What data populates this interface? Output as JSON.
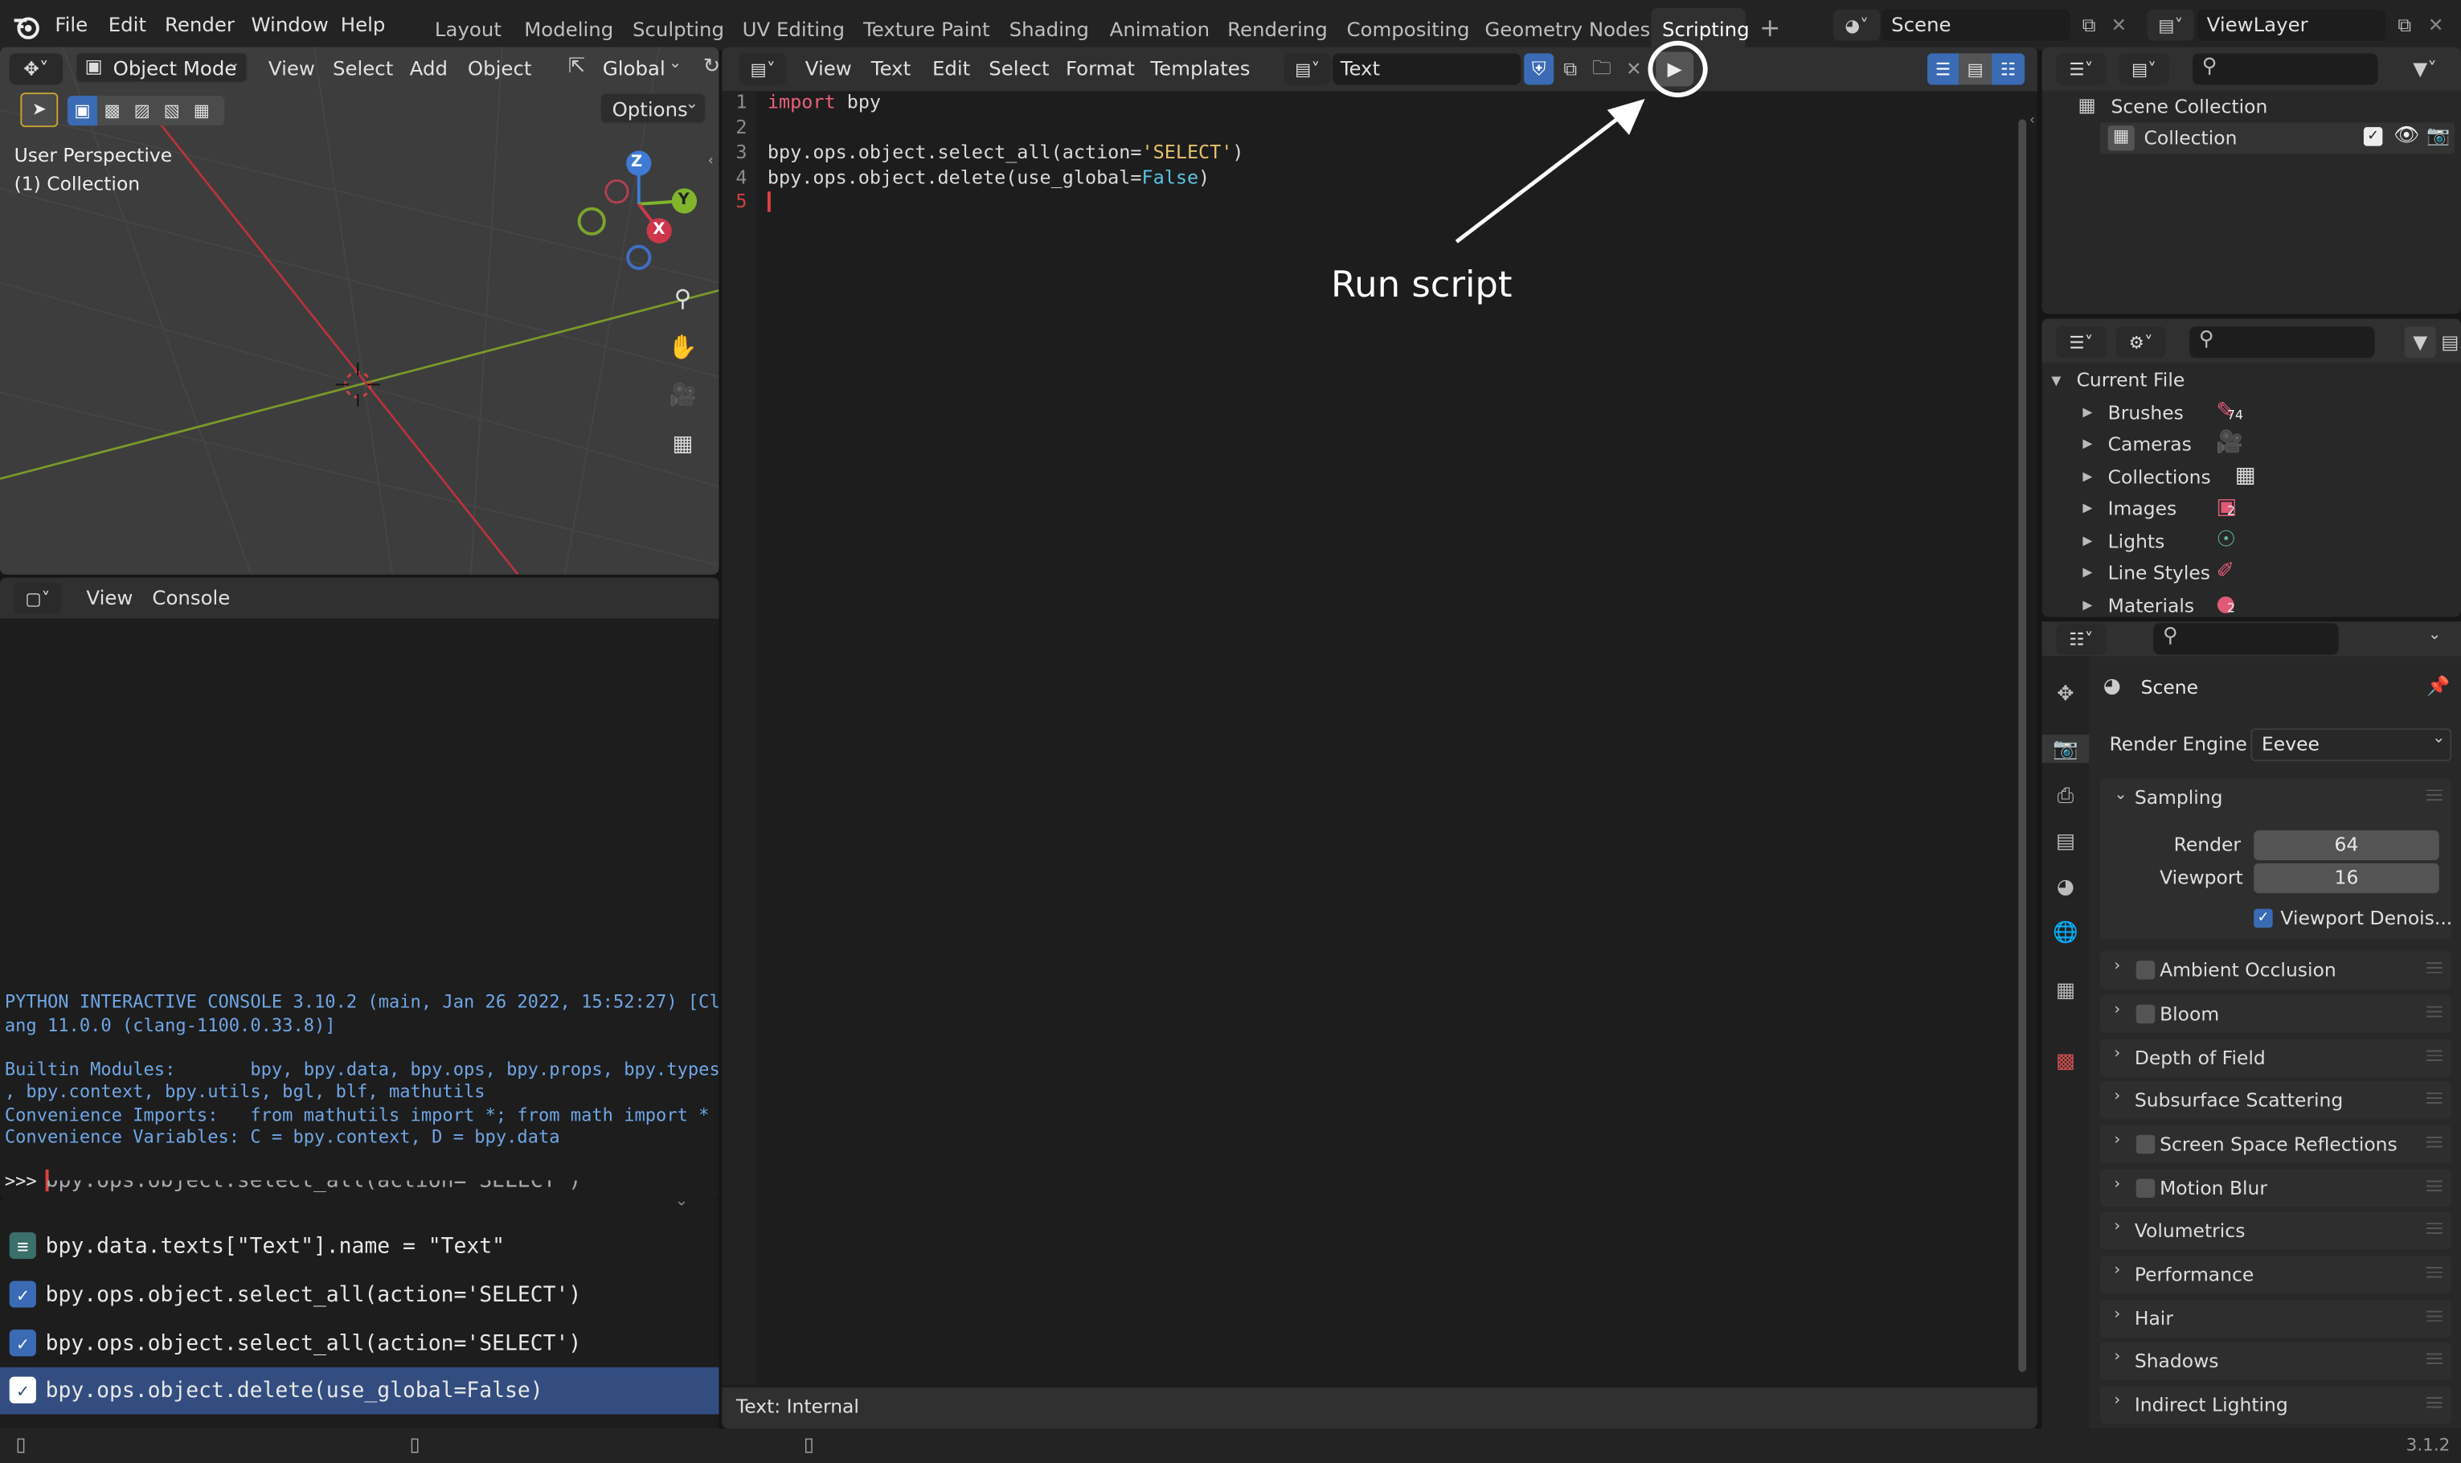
{
  "menubar": {
    "items": [
      "File",
      "Edit",
      "Render",
      "Window",
      "Help"
    ],
    "workspaces": [
      "Layout",
      "Modeling",
      "Sculpting",
      "UV Editing",
      "Texture Paint",
      "Shading",
      "Animation",
      "Rendering",
      "Compositing",
      "Geometry Nodes",
      "Scripting"
    ],
    "active_workspace": "Scripting",
    "scene_name": "Scene",
    "view_layer": "ViewLayer"
  },
  "viewport": {
    "mode": "Object Mode",
    "menus": [
      "View",
      "Select",
      "Add",
      "Object"
    ],
    "orientation": "Global",
    "options_label": "Options",
    "overlay_title": "User Perspective",
    "overlay_collection": "(1) Collection",
    "gizmo": {
      "z": "Z",
      "y": "Y",
      "x": "X"
    }
  },
  "console": {
    "menus": [
      "View",
      "Console"
    ],
    "lines": [
      "PYTHON INTERACTIVE CONSOLE 3.10.2 (main, Jan 26 2022, 15:52:27) [Cl",
      "ang 11.0.0 (clang-1100.0.33.8)]",
      "",
      "Builtin Modules:       bpy, bpy.data, bpy.ops, bpy.props, bpy.types",
      ", bpy.context, bpy.utils, bgl, blf, mathutils",
      "Convenience Imports:   from mathutils import *; from math import *",
      "Convenience Variables: C = bpy.context, D = bpy.data"
    ],
    "prompt": ">>>"
  },
  "info_log": {
    "partial": "bpy.ops.object.select_all(action='SELECT')",
    "rows": [
      {
        "text": "bpy.data.texts[\"Text\"].name = \"Text\"",
        "icon": "properties-icon",
        "selected": false
      },
      {
        "text": "bpy.ops.object.select_all(action='SELECT')",
        "icon": "check-icon",
        "selected": false
      },
      {
        "text": "bpy.ops.object.select_all(action='SELECT')",
        "icon": "check-icon",
        "selected": false
      },
      {
        "text": "bpy.ops.object.delete(use_global=False)",
        "icon": "check-icon",
        "selected": true
      }
    ]
  },
  "text_editor": {
    "menus": [
      "View",
      "Text",
      "Edit",
      "Select",
      "Format",
      "Templates"
    ],
    "text_name": "Text",
    "line_numbers": [
      "1",
      "2",
      "3",
      "4",
      "5"
    ],
    "code": {
      "l1_kw": "import",
      "l1_rest": " bpy",
      "l3_a": "bpy.ops.object.select_all(action=",
      "l3_str": "'SELECT'",
      "l3_b": ")",
      "l4_a": "bpy.ops.object.delete(use_global=",
      "l4_kw": "False",
      "l4_b": ")"
    },
    "status": "Text: Internal",
    "annotation": "Run script"
  },
  "outliner": {
    "scene_collection": "Scene Collection",
    "collection": "Collection"
  },
  "file_browser": {
    "root": "Current File",
    "items": [
      {
        "label": "Brushes",
        "count": "74",
        "color": "#e05a78"
      },
      {
        "label": "Cameras",
        "count": "",
        "color": "#5fb5a0"
      },
      {
        "label": "Collections",
        "count": "",
        "color": "#dddddd"
      },
      {
        "label": "Images",
        "count": "2",
        "color": "#e05a78"
      },
      {
        "label": "Lights",
        "count": "",
        "color": "#5fb5a0"
      },
      {
        "label": "Line Styles",
        "count": "",
        "color": "#e05a78"
      },
      {
        "label": "Materials",
        "count": "2",
        "color": "#e05a78"
      }
    ]
  },
  "properties": {
    "title": "Scene",
    "render_engine_label": "Render Engine",
    "render_engine": "Eevee",
    "sampling": "Sampling",
    "render_label": "Render",
    "render_value": "64",
    "viewport_label": "Viewport",
    "viewport_value": "16",
    "denoise": "Viewport Denois...",
    "sections": [
      {
        "label": "Ambient Occlusion",
        "checkbox": true
      },
      {
        "label": "Bloom",
        "checkbox": true
      },
      {
        "label": "Depth of Field",
        "checkbox": false
      },
      {
        "label": "Subsurface Scattering",
        "checkbox": false
      },
      {
        "label": "Screen Space Reflections",
        "checkbox": true
      },
      {
        "label": "Motion Blur",
        "checkbox": true
      },
      {
        "label": "Volumetrics",
        "checkbox": false
      },
      {
        "label": "Performance",
        "checkbox": false
      },
      {
        "label": "Hair",
        "checkbox": false
      },
      {
        "label": "Shadows",
        "checkbox": false
      },
      {
        "label": "Indirect Lighting",
        "checkbox": false
      }
    ]
  },
  "statusbar": {
    "version": "3.1.2"
  },
  "colors": {
    "accent": "#3a6bb4",
    "x_axis": "#d0364a",
    "y_axis": "#80b52c",
    "z_axis": "#3f7bd4"
  }
}
